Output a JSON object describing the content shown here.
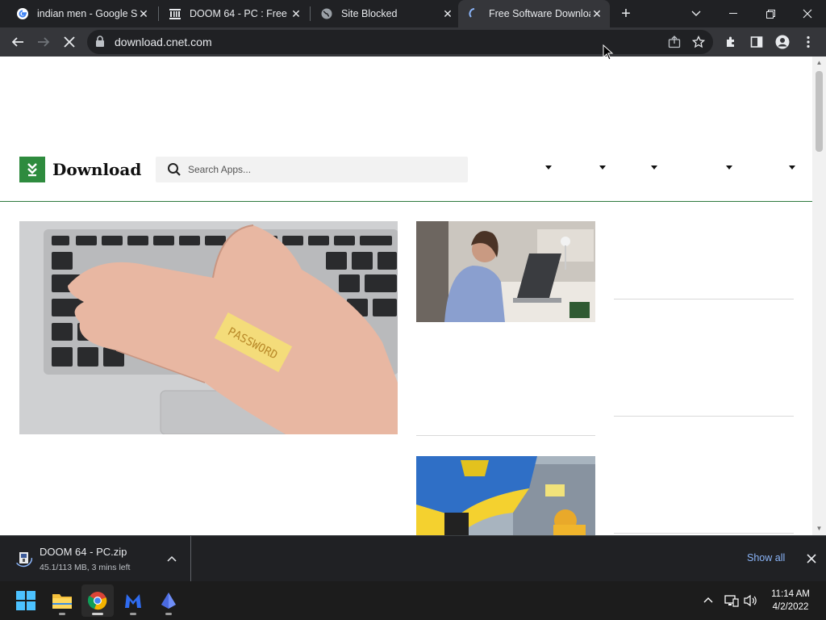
{
  "browser": {
    "tabs": [
      {
        "title": "indian men - Google Se",
        "icon": "google-icon"
      },
      {
        "title": "DOOM 64 - PC : Free D",
        "icon": "archive-icon"
      },
      {
        "title": "Site Blocked",
        "icon": "globe-icon"
      },
      {
        "title": "Free Software Downloa",
        "icon": "loading-icon",
        "active": true
      }
    ],
    "new_tab": "+",
    "url": "download.cnet.com"
  },
  "site": {
    "logo_text": "Download",
    "search_placeholder": "Search Apps...",
    "brand_color": "#2e8b3e"
  },
  "downloads": {
    "file_name": "DOOM 64 - PC.zip",
    "status": "45.1/113 MB, 3 mins left",
    "show_all": "Show all"
  },
  "taskbar": {
    "apps": [
      "start-icon",
      "file-explorer-icon",
      "chrome-icon",
      "malwarebytes-icon",
      "app-icon"
    ],
    "time": "11:14 AM",
    "date": "4/2/2022"
  }
}
